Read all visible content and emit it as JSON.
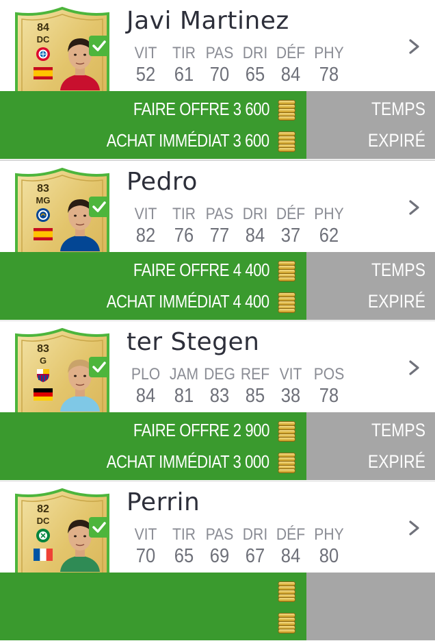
{
  "listings": [
    {
      "name": "Javi Martinez",
      "rating": "84",
      "position": "DC",
      "club_icon": "bayern-crest-icon",
      "flag_icon": "spain-flag-icon",
      "quality": "BAS",
      "quality_icon": "outfield-player-icon",
      "stats": [
        {
          "label": "VIT",
          "value": "52"
        },
        {
          "label": "TIR",
          "value": "61"
        },
        {
          "label": "PAS",
          "value": "70"
        },
        {
          "label": "DRI",
          "value": "65"
        },
        {
          "label": "DÉF",
          "value": "84"
        },
        {
          "label": "PHY",
          "value": "78"
        }
      ],
      "bid_label": "FAIRE OFFRE",
      "bid_value": "3 600",
      "buy_now_label": "ACHAT IMMÉDIAT",
      "buy_now_value": "3 600",
      "time_label": "TEMPS",
      "time_value": "EXPIRÉ"
    },
    {
      "name": "Pedro",
      "rating": "83",
      "position": "MG",
      "club_icon": "chelsea-crest-icon",
      "flag_icon": "spain-flag-icon",
      "quality": "BAS",
      "quality_icon": "outfield-player-icon",
      "stats": [
        {
          "label": "VIT",
          "value": "82"
        },
        {
          "label": "TIR",
          "value": "76"
        },
        {
          "label": "PAS",
          "value": "77"
        },
        {
          "label": "DRI",
          "value": "84"
        },
        {
          "label": "DÉF",
          "value": "37"
        },
        {
          "label": "PHY",
          "value": "62"
        }
      ],
      "bid_label": "FAIRE OFFRE",
      "bid_value": "4 400",
      "buy_now_label": "ACHAT IMMÉDIAT",
      "buy_now_value": "4 400",
      "time_label": "TEMPS",
      "time_value": "EXPIRÉ"
    },
    {
      "name": "ter Stegen",
      "rating": "83",
      "position": "G",
      "club_icon": "barcelona-crest-icon",
      "flag_icon": "germany-flag-icon",
      "quality": "BAS",
      "quality_icon": "goalkeeper-icon",
      "stats": [
        {
          "label": "PLO",
          "value": "84"
        },
        {
          "label": "JAM",
          "value": "81"
        },
        {
          "label": "DEG",
          "value": "83"
        },
        {
          "label": "REF",
          "value": "85"
        },
        {
          "label": "VIT",
          "value": "38"
        },
        {
          "label": "POS",
          "value": "78"
        }
      ],
      "bid_label": "FAIRE OFFRE",
      "bid_value": "2 900",
      "buy_now_label": "ACHAT IMMÉDIAT",
      "buy_now_value": "3 000",
      "time_label": "TEMPS",
      "time_value": "EXPIRÉ"
    },
    {
      "name": "Perrin",
      "rating": "82",
      "position": "DC",
      "club_icon": "saint-etienne-crest-icon",
      "flag_icon": "france-flag-icon",
      "quality": "BAS",
      "quality_icon": "outfield-player-icon",
      "stats": [
        {
          "label": "VIT",
          "value": "70"
        },
        {
          "label": "TIR",
          "value": "65"
        },
        {
          "label": "PAS",
          "value": "69"
        },
        {
          "label": "DRI",
          "value": "67"
        },
        {
          "label": "DÉF",
          "value": "84"
        },
        {
          "label": "PHY",
          "value": "80"
        }
      ],
      "bid_label": "",
      "bid_value": "",
      "buy_now_label": "",
      "buy_now_value": "",
      "time_label": "",
      "time_value": ""
    }
  ],
  "colors": {
    "green_band": "#3a9a2e",
    "grey_band": "#a6a6a6",
    "check_badge": "#4db53c",
    "card_gold": "#e8cf7a"
  }
}
